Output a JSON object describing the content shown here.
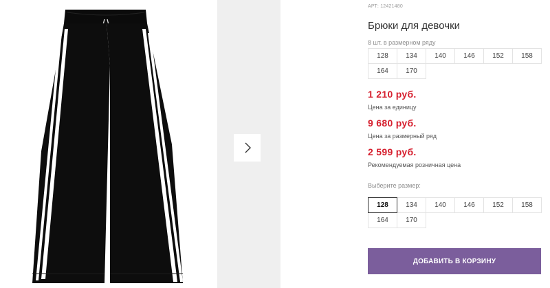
{
  "product": {
    "article": "АРТ: 12421480",
    "title": "Брюки для девочки",
    "image_alt_icon": "pants-product-image"
  },
  "size_row": {
    "caption": "8 шт. в размерном ряду",
    "sizes": [
      "128",
      "134",
      "140",
      "146",
      "152",
      "158",
      "164",
      "170"
    ]
  },
  "prices": [
    {
      "amount": "1 210 руб.",
      "label": "Цена за единицу"
    },
    {
      "amount": "9 680 руб.",
      "label": "Цена за размерный ряд"
    },
    {
      "amount": "2 599 руб.",
      "label": "Рекомендуемая розничная цена"
    }
  ],
  "size_select": {
    "label": "Выберите размер:",
    "sizes": [
      "128",
      "134",
      "140",
      "146",
      "152",
      "158",
      "164",
      "170"
    ],
    "selected": "128"
  },
  "cart": {
    "button_label": "ДОБАВИТЬ В КОРЗИНУ"
  },
  "gallery": {
    "next_icon": "chevron-right-icon"
  },
  "colors": {
    "accent": "#7b5e9c",
    "price": "#d6202f"
  }
}
